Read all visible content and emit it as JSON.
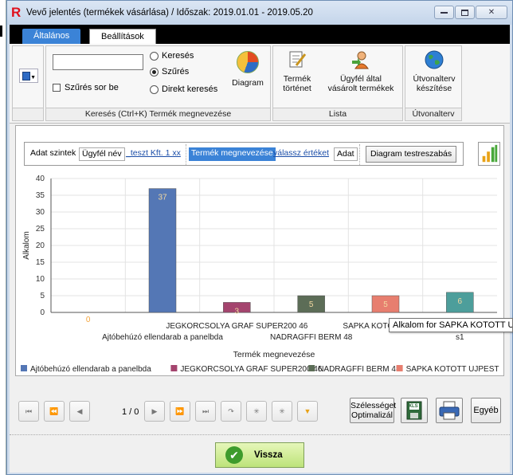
{
  "window": {
    "title": "Vevő jelentés (termékek vásárlása) / Időszak: 2019.01.01 - 2019.05.20",
    "close_symbol": "✕"
  },
  "tabs": [
    {
      "label": "Általános",
      "active": true
    },
    {
      "label": "Beállítások",
      "active": false
    }
  ],
  "ribbon": {
    "search": {
      "input_value": "",
      "filter_checkbox_label": "Szűrés sor be",
      "filter_checked": false,
      "radio_options": [
        {
          "label": "Keresés",
          "selected": false
        },
        {
          "label": "Szűrés",
          "selected": true
        },
        {
          "label": "Direkt keresés",
          "selected": false
        }
      ],
      "diagram_label": "Diagram",
      "group_label": "Keresés (Ctrl+K) Termék megnevezése"
    },
    "lista": {
      "termek_tortenet": [
        "Termék",
        "történet"
      ],
      "ugyfel_vasarolt": [
        "Ügyfél által",
        "vásárolt termékek"
      ],
      "group_label": "Lista"
    },
    "utvonalterv": {
      "button": [
        "Útvonalterv",
        "készítése"
      ],
      "group_label": "Útvonalterv"
    }
  },
  "levels_toolbar": {
    "prefix": "Adat szintek",
    "items": [
      {
        "text": "Ügyfél név",
        "style": "boxed"
      },
      {
        "text": "_teszt Kft. 1 xx",
        "style": "link"
      },
      {
        "text": "Termék megnevezése",
        "style": "selected"
      },
      {
        "text": "válassz értéket",
        "style": "link"
      },
      {
        "text": "Adat",
        "style": "boxed"
      }
    ],
    "customize_button": "Diagram testreszabás"
  },
  "chart_data": {
    "type": "bar",
    "ylabel": "Alkalom",
    "xlabel": "Termék megnevezése",
    "ylim": [
      0,
      40
    ],
    "yticks": [
      0,
      5,
      10,
      15,
      20,
      25,
      30,
      35,
      40
    ],
    "grid": true,
    "categories": [
      "0",
      "Ajtóbehúzó ellendarab a panelbda",
      "JEGKORCSOLYA GRAF SUPER200 46",
      "NADRAGFFI BERM 48",
      "SAPKA KOTOTT UJPEST",
      "s1"
    ],
    "x_tick_labels_visible": [
      "JEGKORCSOLYA GRAF SUPER200 46",
      "Ajtóbehúzó ellendarab a panelbda",
      "NADRAGFFI BERM 48",
      "SAPKA KOTOT",
      "s1"
    ],
    "series": [
      {
        "name": "",
        "values": [
          0,
          37,
          3,
          5,
          5,
          6
        ],
        "colors": [
          "#f4a43b",
          "#5477b5",
          "#a4446e",
          "#5c6d57",
          "#e77e6f",
          "#4d9e9b"
        ]
      }
    ],
    "data_labels": [
      "0",
      "37",
      "3",
      "5",
      "5",
      "6"
    ],
    "legend": {
      "placement": "bottom",
      "entries": [
        {
          "label": "Ajtóbehúzó ellendarab a panelbda",
          "color": "#5477b5"
        },
        {
          "label": "JEGKORCSOLYA GRAF SUPER200 46",
          "color": "#a4446e"
        },
        {
          "label": "NADRAGFFI BERM 48",
          "color": "#5c6d57"
        },
        {
          "label": "SAPKA KOTOTT UJPEST",
          "color": "#e77e6f"
        }
      ]
    }
  },
  "tooltip": "Alkalom for SAPKA KOTOTT UJPEST",
  "navigator": {
    "page_info": "1 / 0",
    "buttons": [
      "⏮",
      "⏪",
      "◀",
      "▶",
      "⏩",
      "⏭",
      "↷",
      "✳",
      "✳",
      "▼"
    ],
    "optimize_button": [
      "Szélességet",
      "Optimalizál"
    ],
    "other_button": "Egyéb",
    "xls_badge": "XLS"
  },
  "footer": {
    "back_button": "Vissza",
    "check_symbol": "✔"
  }
}
